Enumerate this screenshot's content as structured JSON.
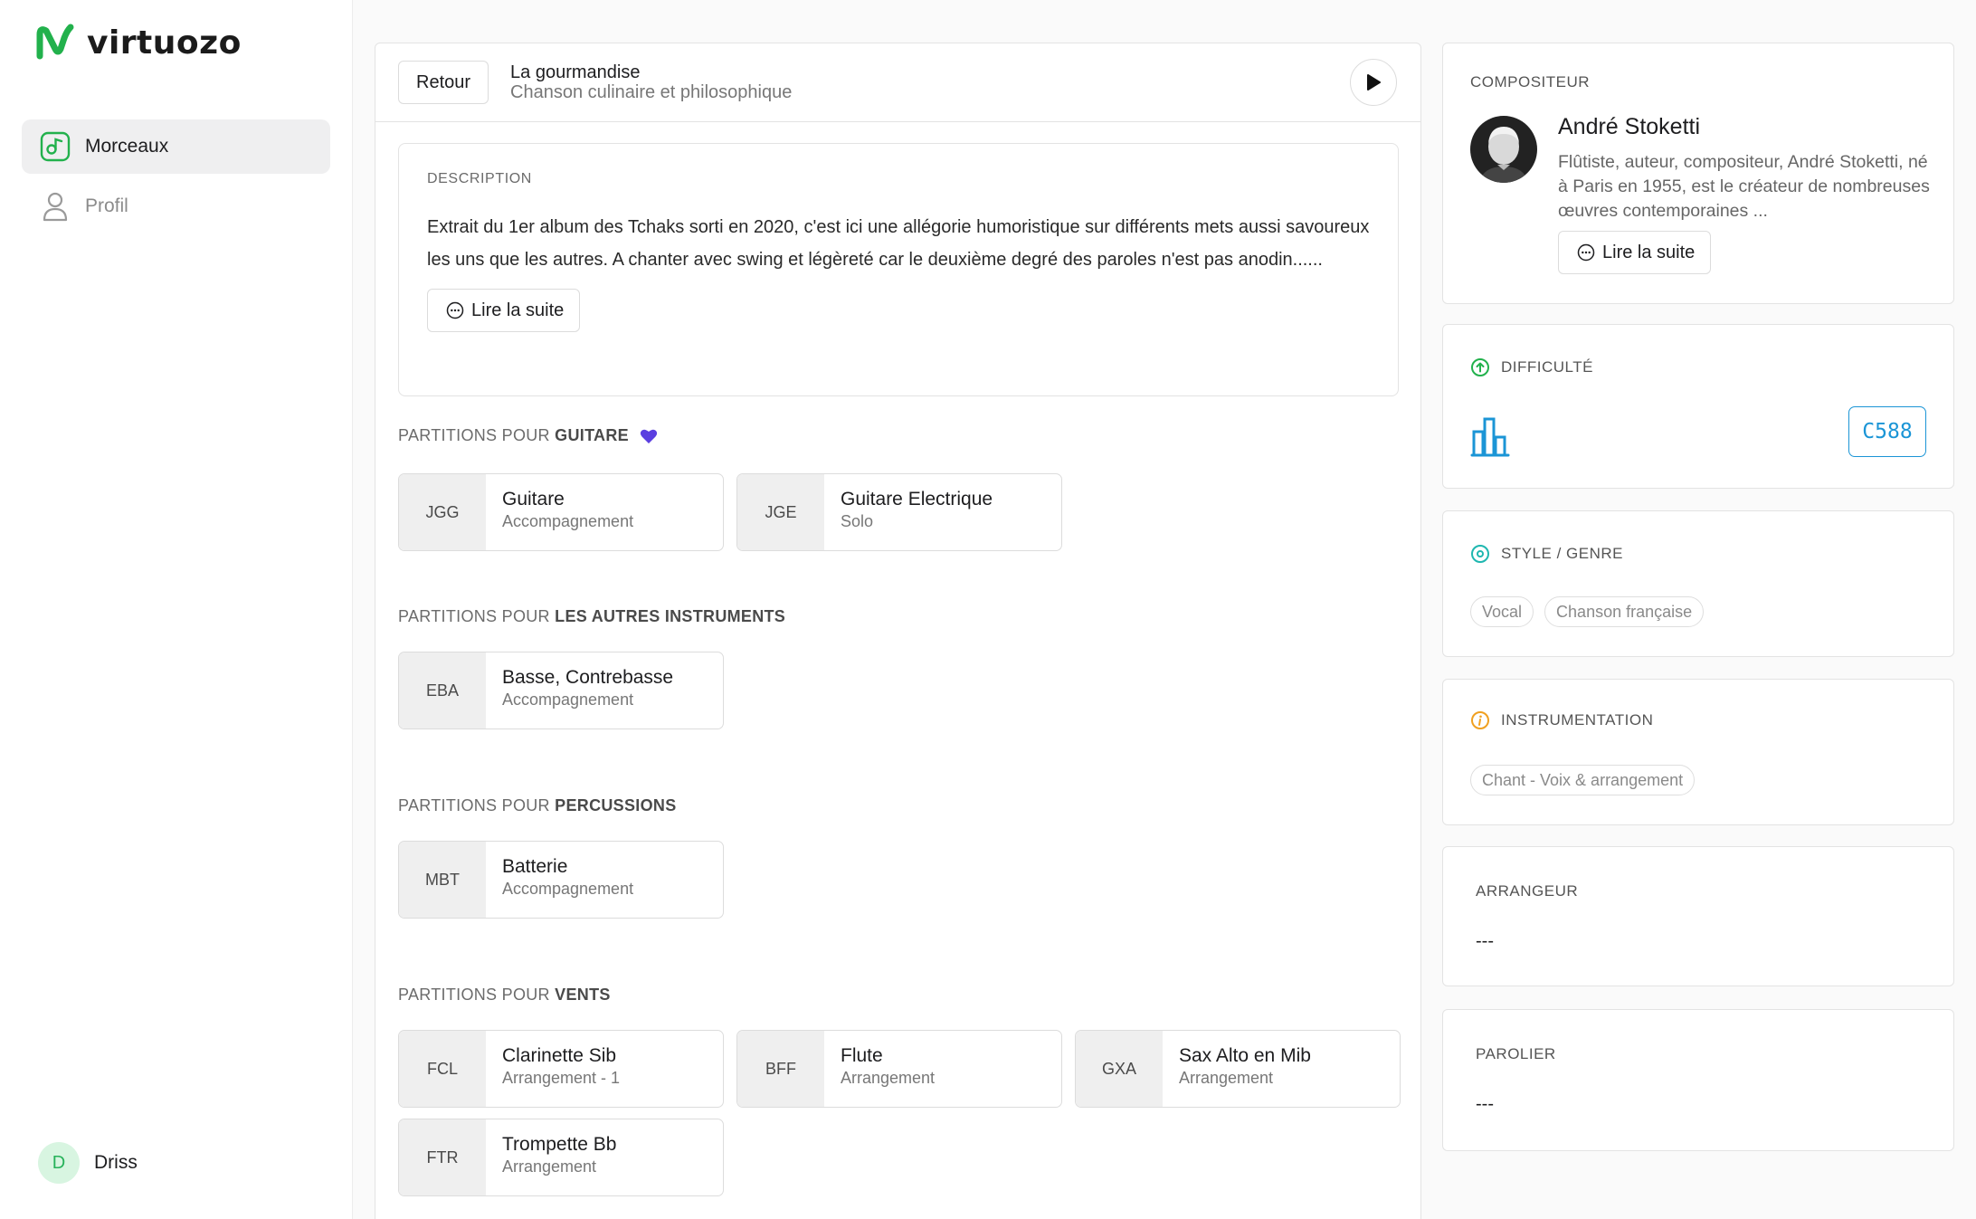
{
  "app": {
    "name": "virtuozo",
    "brand_color": "#22b14c"
  },
  "sidebar": {
    "items": [
      {
        "label": "Morceaux",
        "icon": "music-note-icon",
        "active": true
      },
      {
        "label": "Profil",
        "icon": "user-icon",
        "active": false
      }
    ],
    "user": {
      "initial": "D",
      "name": "Driss"
    }
  },
  "header": {
    "back_label": "Retour",
    "title": "La gourmandise",
    "subtitle": "Chanson culinaire et philosophique",
    "play_icon": "play-icon"
  },
  "description": {
    "label": "DESCRIPTION",
    "text": "Extrait du 1er album des Tchaks sorti en 2020, c'est ici une allégorie humoristique sur différents mets aussi savoureux les uns que les autres. A chanter avec swing et légèreté car le deuxième degré des paroles n'est pas anodin......",
    "more_label": "Lire la suite"
  },
  "sections": [
    {
      "prefix": "PARTITIONS POUR",
      "name": "GUITARE",
      "favorite": true,
      "scores": [
        {
          "code": "JGG",
          "name": "Guitare",
          "type": "Accompagnement"
        },
        {
          "code": "JGE",
          "name": "Guitare Electrique",
          "type": "Solo"
        }
      ]
    },
    {
      "prefix": "PARTITIONS POUR",
      "name": "LES AUTRES INSTRUMENTS",
      "scores": [
        {
          "code": "EBA",
          "name": "Basse, Contrebasse",
          "type": "Accompagnement"
        }
      ]
    },
    {
      "prefix": "PARTITIONS POUR",
      "name": "PERCUSSIONS",
      "scores": [
        {
          "code": "MBT",
          "name": "Batterie",
          "type": "Accompagnement"
        }
      ]
    },
    {
      "prefix": "PARTITIONS POUR",
      "name": "VENTS",
      "scores": [
        {
          "code": "FCL",
          "name": "Clarinette Sib",
          "type": "Arrangement - 1"
        },
        {
          "code": "BFF",
          "name": "Flute",
          "type": "Arrangement"
        },
        {
          "code": "GXA",
          "name": "Sax Alto en Mib",
          "type": "Arrangement"
        },
        {
          "code": "FTR",
          "name": "Trompette Bb",
          "type": "Arrangement"
        }
      ]
    }
  ],
  "composer": {
    "label": "COMPOSITEUR",
    "name": "André Stoketti",
    "bio": "Flûtiste, auteur, compositeur, André Stoketti, né à Paris en 1955, est le créateur de nombreuses œuvres contemporaines ...",
    "more_label": "Lire la suite"
  },
  "difficulty": {
    "label": "DIFFICULTÉ",
    "level": "C588",
    "color": "#1b95d6"
  },
  "style": {
    "label": "STYLE / GENRE",
    "chips": [
      "Vocal",
      "Chanson française"
    ]
  },
  "instrumentation": {
    "label": "INSTRUMENTATION",
    "chips": [
      "Chant - Voix & arrangement"
    ]
  },
  "arranger": {
    "label": "ARRANGEUR",
    "value": "---"
  },
  "lyricist": {
    "label": "PAROLIER",
    "value": "---"
  }
}
